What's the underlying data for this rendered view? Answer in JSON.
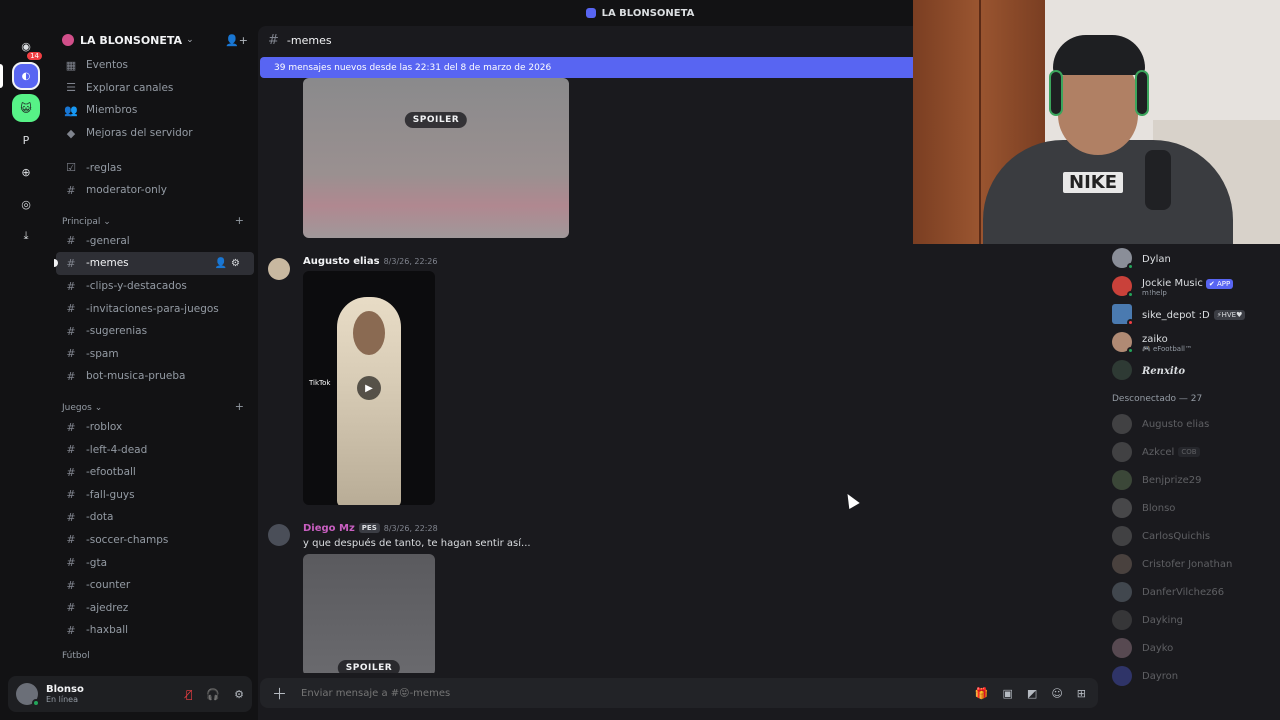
{
  "window": {
    "title": "LA BLONSONETA"
  },
  "rail": {
    "badge": "14",
    "letter": "P"
  },
  "server": {
    "name": "LA BLONSONETA",
    "nav": [
      "Eventos",
      "Explorar canales",
      "Miembros",
      "Mejoras del servidor"
    ],
    "top_channels": [
      "-reglas",
      "moderator-only"
    ],
    "categories": [
      {
        "name": "Principal",
        "channels": [
          "-general",
          "-memes",
          "-clips-y-destacados",
          "-invitaciones-para-juegos",
          "-sugerenias",
          "-spam",
          "bot-musica-prueba"
        ]
      },
      {
        "name": "Juegos",
        "channels": [
          "-roblox",
          "-left-4-dead",
          "-efootball",
          "-fall-guys",
          "-dota",
          "-soccer-champs",
          "-gta",
          "-counter",
          "-ajedrez",
          "-haxball"
        ]
      }
    ],
    "next_category": "Fútbol"
  },
  "user": {
    "name": "Blonso",
    "status": "En línea"
  },
  "channel": {
    "name": "-memes",
    "banner": "39 mensajes nuevos desde las 22:31 del 8 de marzo de 2026",
    "composer_placeholder": "Enviar mensaje a #😝-memes"
  },
  "messages": [
    {
      "attachment": "SPOILER"
    },
    {
      "author": "Augusto elias",
      "time": "8/3/26, 22:26",
      "video_label": "TikTok"
    },
    {
      "author": "Diego Mz",
      "badge": "PES",
      "time": "8/3/26, 22:28",
      "text": "y que después de tanto, te hagan sentir así...",
      "attachment": "SPOILER"
    }
  ],
  "members": {
    "online": [
      {
        "name": "Dylan",
        "sub": ""
      },
      {
        "name": "Jockie Music",
        "badge": "✔ APP",
        "sub": "m!help"
      },
      {
        "name": "sike_depot :D",
        "badge": "⚡HVE♥",
        "sub": ""
      },
      {
        "name": "zaiko",
        "sub": "🎮 eFootball™"
      },
      {
        "name": "Renxito",
        "sub": ""
      }
    ],
    "offline_title": "Desconectado — 27",
    "offline": [
      "Augusto elias",
      "Azkcel",
      "Benjprize29",
      "Blonso",
      "CarlosQuichis",
      "Cristofer Jonathan",
      "DanferVilchez66",
      "Dayking",
      "Dayko",
      "Dayron"
    ],
    "offline_badge": "COB"
  },
  "webcam": {
    "shirt_text": "NIKE"
  },
  "colors": {
    "accent": "#5865f2",
    "online": "#23a55a",
    "danger": "#f23f43"
  }
}
